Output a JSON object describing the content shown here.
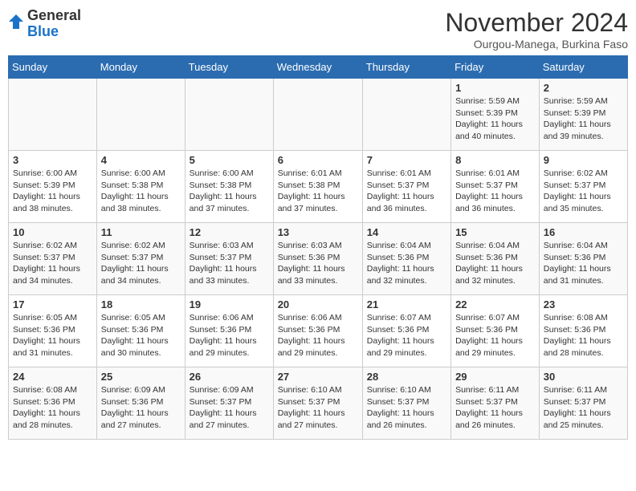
{
  "header": {
    "logo_general": "General",
    "logo_blue": "Blue",
    "month_title": "November 2024",
    "location": "Ourgou-Manega, Burkina Faso"
  },
  "calendar": {
    "days_of_week": [
      "Sunday",
      "Monday",
      "Tuesday",
      "Wednesday",
      "Thursday",
      "Friday",
      "Saturday"
    ],
    "weeks": [
      [
        {
          "day": "",
          "info": ""
        },
        {
          "day": "",
          "info": ""
        },
        {
          "day": "",
          "info": ""
        },
        {
          "day": "",
          "info": ""
        },
        {
          "day": "",
          "info": ""
        },
        {
          "day": "1",
          "info": "Sunrise: 5:59 AM\nSunset: 5:39 PM\nDaylight: 11 hours and 40 minutes."
        },
        {
          "day": "2",
          "info": "Sunrise: 5:59 AM\nSunset: 5:39 PM\nDaylight: 11 hours and 39 minutes."
        }
      ],
      [
        {
          "day": "3",
          "info": "Sunrise: 6:00 AM\nSunset: 5:39 PM\nDaylight: 11 hours and 38 minutes."
        },
        {
          "day": "4",
          "info": "Sunrise: 6:00 AM\nSunset: 5:38 PM\nDaylight: 11 hours and 38 minutes."
        },
        {
          "day": "5",
          "info": "Sunrise: 6:00 AM\nSunset: 5:38 PM\nDaylight: 11 hours and 37 minutes."
        },
        {
          "day": "6",
          "info": "Sunrise: 6:01 AM\nSunset: 5:38 PM\nDaylight: 11 hours and 37 minutes."
        },
        {
          "day": "7",
          "info": "Sunrise: 6:01 AM\nSunset: 5:37 PM\nDaylight: 11 hours and 36 minutes."
        },
        {
          "day": "8",
          "info": "Sunrise: 6:01 AM\nSunset: 5:37 PM\nDaylight: 11 hours and 36 minutes."
        },
        {
          "day": "9",
          "info": "Sunrise: 6:02 AM\nSunset: 5:37 PM\nDaylight: 11 hours and 35 minutes."
        }
      ],
      [
        {
          "day": "10",
          "info": "Sunrise: 6:02 AM\nSunset: 5:37 PM\nDaylight: 11 hours and 34 minutes."
        },
        {
          "day": "11",
          "info": "Sunrise: 6:02 AM\nSunset: 5:37 PM\nDaylight: 11 hours and 34 minutes."
        },
        {
          "day": "12",
          "info": "Sunrise: 6:03 AM\nSunset: 5:37 PM\nDaylight: 11 hours and 33 minutes."
        },
        {
          "day": "13",
          "info": "Sunrise: 6:03 AM\nSunset: 5:36 PM\nDaylight: 11 hours and 33 minutes."
        },
        {
          "day": "14",
          "info": "Sunrise: 6:04 AM\nSunset: 5:36 PM\nDaylight: 11 hours and 32 minutes."
        },
        {
          "day": "15",
          "info": "Sunrise: 6:04 AM\nSunset: 5:36 PM\nDaylight: 11 hours and 32 minutes."
        },
        {
          "day": "16",
          "info": "Sunrise: 6:04 AM\nSunset: 5:36 PM\nDaylight: 11 hours and 31 minutes."
        }
      ],
      [
        {
          "day": "17",
          "info": "Sunrise: 6:05 AM\nSunset: 5:36 PM\nDaylight: 11 hours and 31 minutes."
        },
        {
          "day": "18",
          "info": "Sunrise: 6:05 AM\nSunset: 5:36 PM\nDaylight: 11 hours and 30 minutes."
        },
        {
          "day": "19",
          "info": "Sunrise: 6:06 AM\nSunset: 5:36 PM\nDaylight: 11 hours and 29 minutes."
        },
        {
          "day": "20",
          "info": "Sunrise: 6:06 AM\nSunset: 5:36 PM\nDaylight: 11 hours and 29 minutes."
        },
        {
          "day": "21",
          "info": "Sunrise: 6:07 AM\nSunset: 5:36 PM\nDaylight: 11 hours and 29 minutes."
        },
        {
          "day": "22",
          "info": "Sunrise: 6:07 AM\nSunset: 5:36 PM\nDaylight: 11 hours and 29 minutes."
        },
        {
          "day": "23",
          "info": "Sunrise: 6:08 AM\nSunset: 5:36 PM\nDaylight: 11 hours and 28 minutes."
        }
      ],
      [
        {
          "day": "24",
          "info": "Sunrise: 6:08 AM\nSunset: 5:36 PM\nDaylight: 11 hours and 28 minutes."
        },
        {
          "day": "25",
          "info": "Sunrise: 6:09 AM\nSunset: 5:36 PM\nDaylight: 11 hours and 27 minutes."
        },
        {
          "day": "26",
          "info": "Sunrise: 6:09 AM\nSunset: 5:37 PM\nDaylight: 11 hours and 27 minutes."
        },
        {
          "day": "27",
          "info": "Sunrise: 6:10 AM\nSunset: 5:37 PM\nDaylight: 11 hours and 27 minutes."
        },
        {
          "day": "28",
          "info": "Sunrise: 6:10 AM\nSunset: 5:37 PM\nDaylight: 11 hours and 26 minutes."
        },
        {
          "day": "29",
          "info": "Sunrise: 6:11 AM\nSunset: 5:37 PM\nDaylight: 11 hours and 26 minutes."
        },
        {
          "day": "30",
          "info": "Sunrise: 6:11 AM\nSunset: 5:37 PM\nDaylight: 11 hours and 25 minutes."
        }
      ]
    ]
  }
}
